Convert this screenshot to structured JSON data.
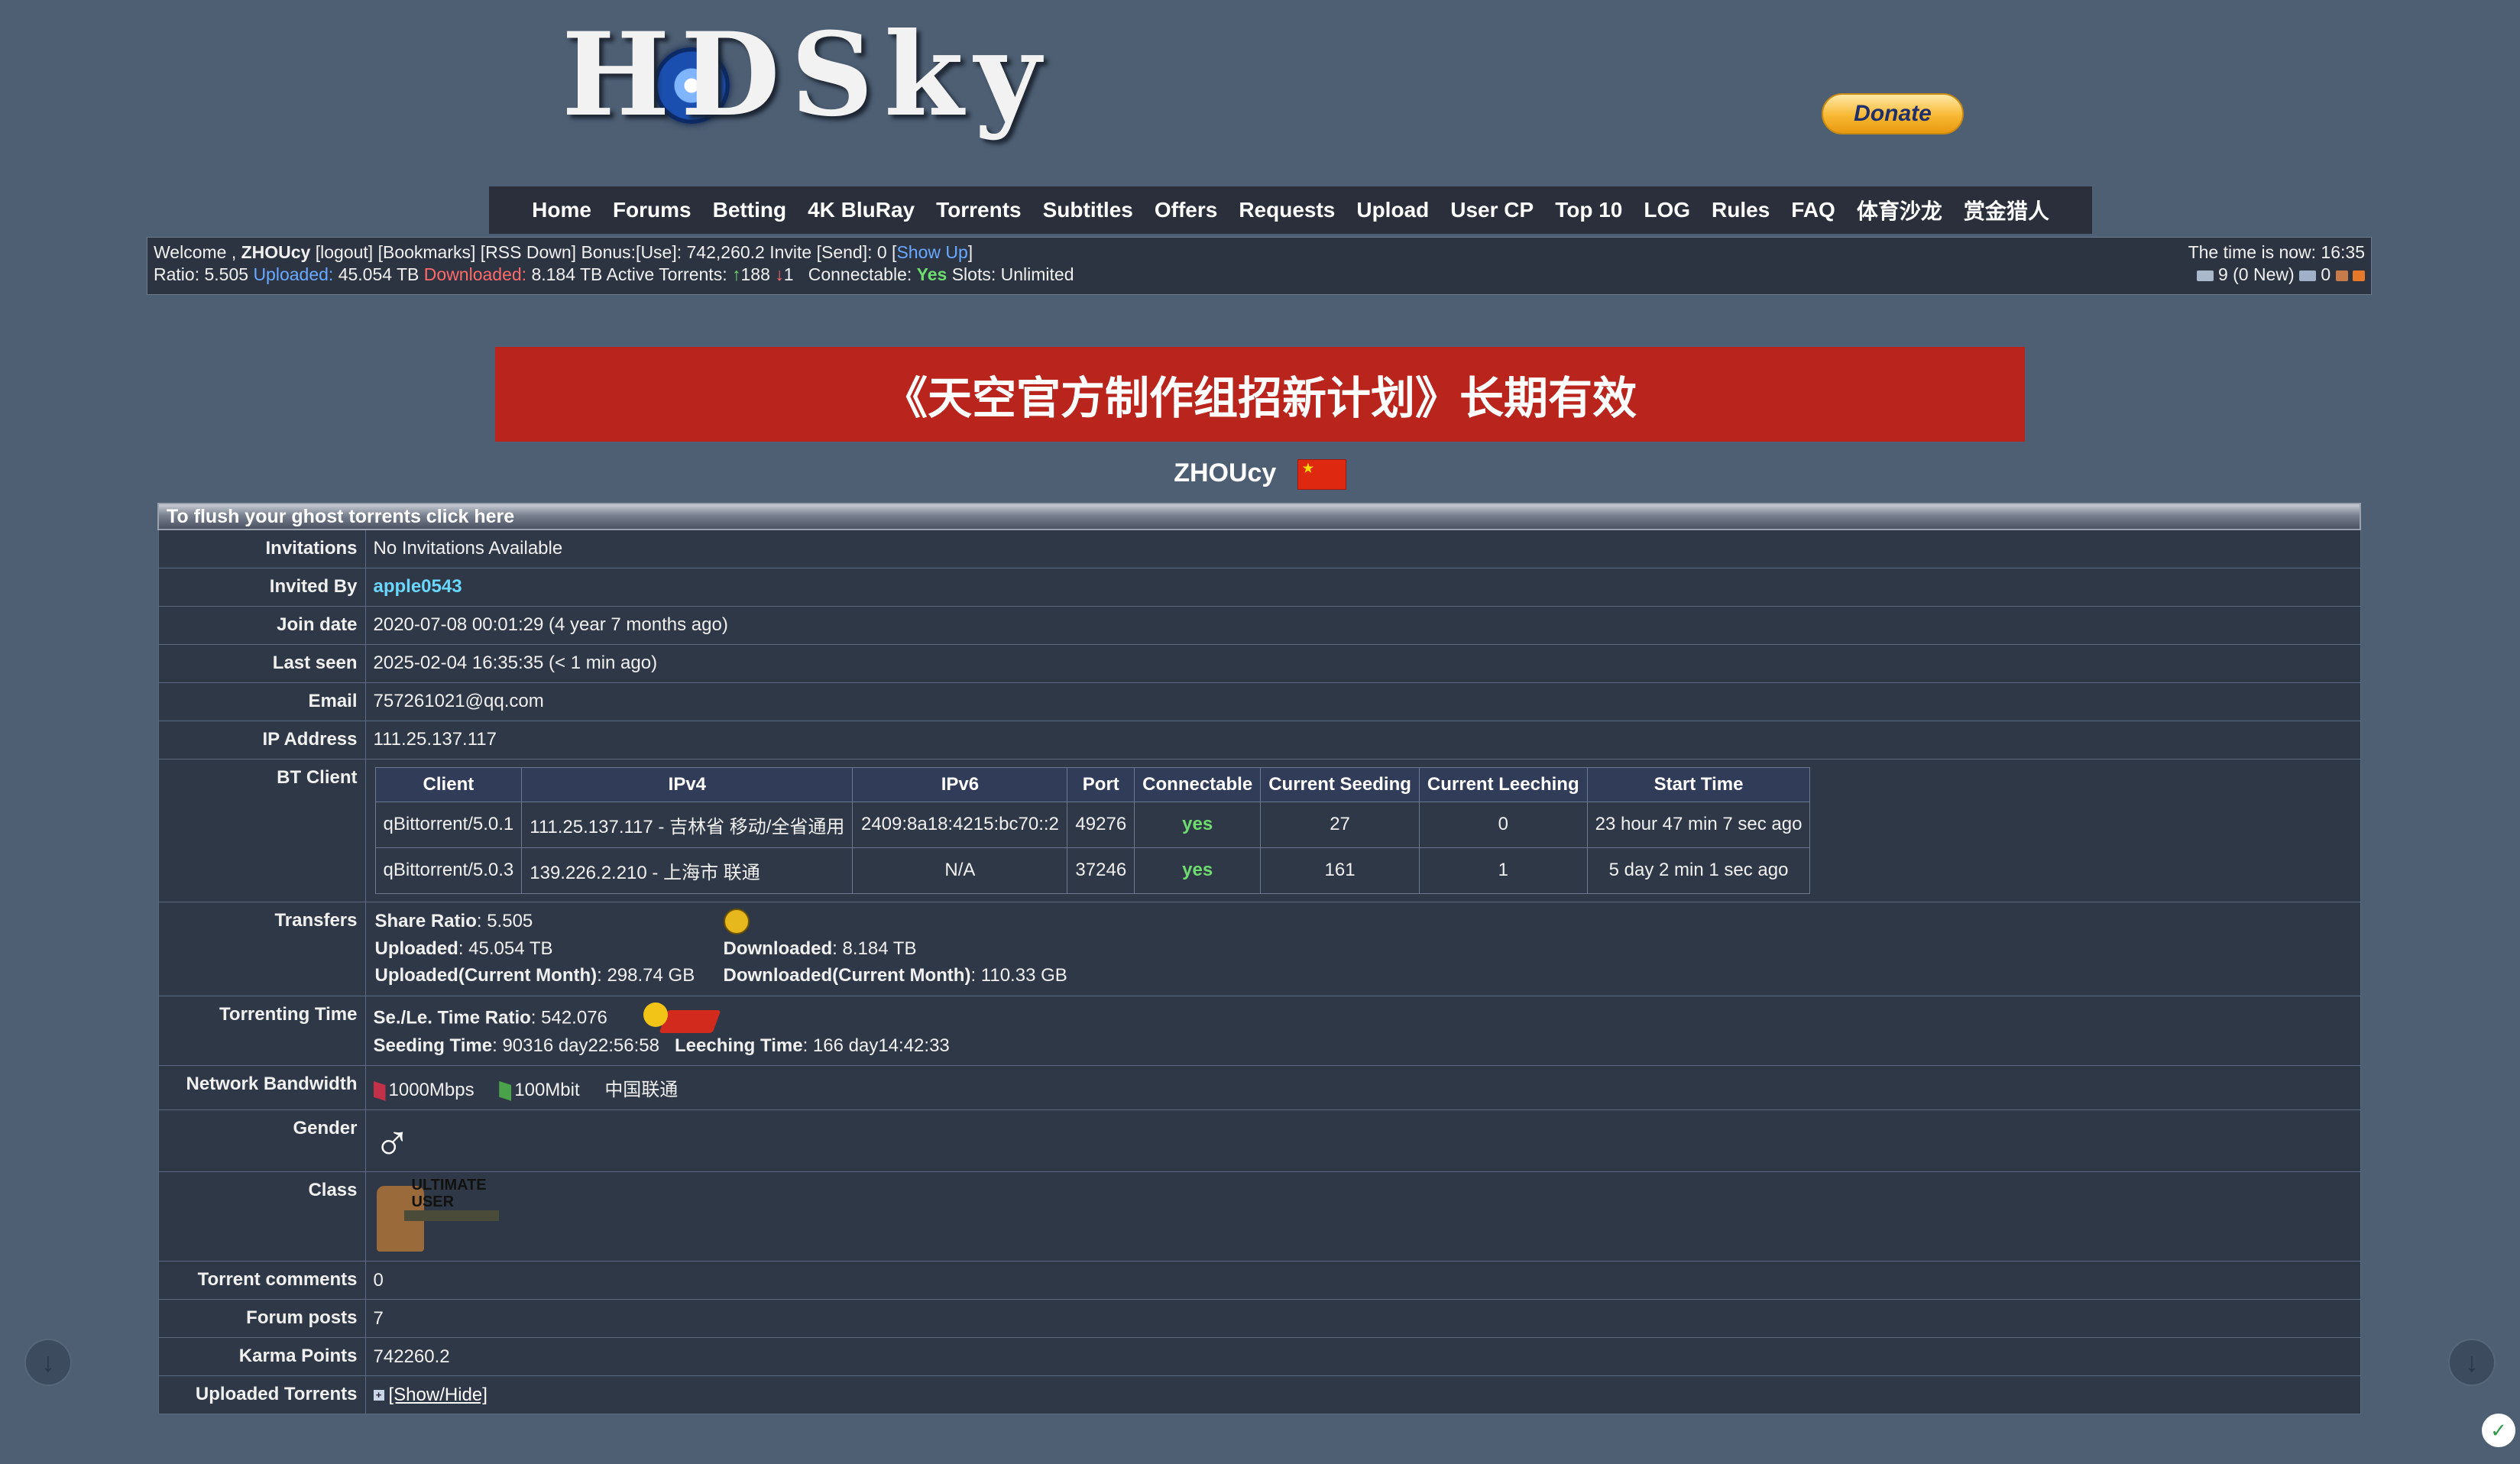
{
  "site": {
    "logo_text": "HDSky",
    "donate_label": "Donate"
  },
  "nav": [
    "Home",
    "Forums",
    "Betting",
    "4K BluRay",
    "Torrents",
    "Subtitles",
    "Offers",
    "Requests",
    "Upload",
    "User CP",
    "Top 10",
    "LOG",
    "Rules",
    "FAQ",
    "体育沙龙",
    "赏金猎人"
  ],
  "infobar": {
    "welcome": "Welcome ,",
    "username": "ZHOUcy",
    "links": "[logout] [Bookmarks] [RSS Down]",
    "bonus": "Bonus:[Use]: 742,260.2",
    "invite": "Invite [Send]: 0",
    "show_up": "Show Up",
    "ratio_label": "Ratio:",
    "ratio": "5.505",
    "uploaded_label": "Uploaded:",
    "uploaded": "45.054 TB",
    "downloaded_label": "Downloaded:",
    "downloaded": "8.184 TB",
    "active_label": "Active Torrents:",
    "active_up": "188",
    "active_down": "1",
    "connectable_label": "Connectable:",
    "connectable": "Yes",
    "slots": "Slots: Unlimited",
    "time_now": "The time is now: 16:35",
    "messages": "9 (0 New)",
    "message_count_2": "0"
  },
  "banner": "《天空官方制作组招新计划》长期有效",
  "profile_name": "ZHOUcy",
  "flush_link": "To flush your ghost torrents click here",
  "profile": {
    "invitations_label": "Invitations",
    "invitations": "No Invitations Available",
    "invited_by_label": "Invited By",
    "invited_by": "apple0543",
    "join_date_label": "Join date",
    "join_date": "2020-07-08 00:01:29 (4 year 7 months ago)",
    "last_seen_label": "Last seen",
    "last_seen": "2025-02-04 16:35:35 (< 1 min ago)",
    "email_label": "Email",
    "email": "757261021@qq.com",
    "ip_label": "IP Address",
    "ip": "111.25.137.117",
    "bt_client_label": "BT Client",
    "transfers_label": "Transfers",
    "torrenting_time_label": "Torrenting Time",
    "bandwidth_label": "Network Bandwidth",
    "gender_label": "Gender",
    "class_label": "Class",
    "class_text": "ULTIMATE USER",
    "comments_label": "Torrent comments",
    "comments": "0",
    "forum_posts_label": "Forum posts",
    "forum_posts": "7",
    "karma_label": "Karma Points",
    "karma": "742260.2",
    "uploaded_torrents_label": "Uploaded Torrents",
    "show_hide": "[Show/Hide]"
  },
  "bt_clients": {
    "headers": [
      "Client",
      "IPv4",
      "IPv6",
      "Port",
      "Connectable",
      "Current Seeding",
      "Current Leeching",
      "Start Time"
    ],
    "rows": [
      [
        "qBittorrent/5.0.1",
        "111.25.137.117 - 吉林省 移动/全省通用",
        "2409:8a18:4215:bc70::2",
        "49276",
        "yes",
        "27",
        "0",
        "23 hour 47 min 7 sec ago"
      ],
      [
        "qBittorrent/5.0.3",
        "139.226.2.210 - 上海市 联通",
        "N/A",
        "37246",
        "yes",
        "161",
        "1",
        "5 day 2 min 1 sec ago"
      ]
    ]
  },
  "transfers": {
    "share_ratio_label": "Share Ratio",
    "share_ratio": ": 5.505",
    "uploaded_label": "Uploaded",
    "uploaded": ": 45.054 TB",
    "downloaded_label": "Downloaded",
    "downloaded": ": 8.184 TB",
    "uploaded_month_label": "Uploaded(Current Month)",
    "uploaded_month": ": 298.74 GB",
    "downloaded_month_label": "Downloaded(Current Month)",
    "downloaded_month": ": 110.33 GB"
  },
  "torrenting_time": {
    "ratio_label": "Se./Le. Time Ratio",
    "ratio": ": 542.076",
    "seeding_label": "Seeding Time",
    "seeding": ": 90316 day22:56:58",
    "leeching_label": "Leeching Time",
    "leeching": ": 166 day14:42:33"
  },
  "bandwidth": {
    "down": "1000Mbps",
    "up": "100Mbit",
    "isp": "中国联通"
  },
  "gender_symbol": "♂",
  "colors": {
    "background": "#4e5f74",
    "nav": "#2a2f3b",
    "banner": "#b9241c",
    "uploaded": "#6aa9ff",
    "downloaded": "#ff6a6a",
    "yes": "#6fdc6f",
    "link": "#6ad7ff"
  }
}
